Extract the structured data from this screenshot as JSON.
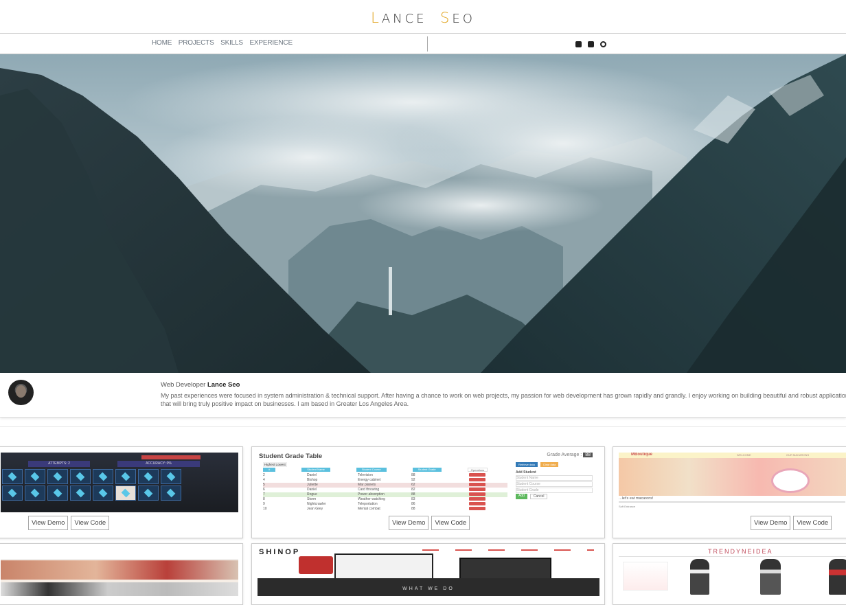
{
  "brand": {
    "first_initial": "L",
    "first_rest": "ANCE",
    "last_initial": "S",
    "last_rest": "EO",
    "accent_color": "#e0a21b"
  },
  "nav": {
    "links": [
      "HOME",
      "PROJECTS",
      "SKILLS",
      "EXPERIENCE"
    ]
  },
  "social": {
    "icons": [
      "linkedin-icon",
      "instagram-icon",
      "github-icon"
    ]
  },
  "bio": {
    "role": "Web Developer",
    "name": "Lance Seo",
    "text": "My past experiences were focused in system administration & technical support. After having a chance to work on web projects, my passion for web development has grown rapidly and grandly. I enjoy working on building beautiful and robust applications that will bring truly positive impact on businesses. I am based in Greater Los Angeles Area."
  },
  "projects": {
    "demo_label": "View Demo",
    "code_label": "View Code",
    "memory": {
      "banner": "ATTEMPTS: 2",
      "accuracy": "ACCURACY: 0%"
    },
    "grades": {
      "title": "Student Grade Table",
      "average_label": "Grade Average :",
      "average_value": "88",
      "sort_label": "Highest   Lowest",
      "headers": [
        "Student Name",
        "Student Course",
        "Student Grade",
        "Operations"
      ],
      "rows": [
        [
          "2",
          "Daniel",
          "Television",
          "88"
        ],
        [
          "4",
          "Bishop",
          "Energy cabinet",
          "92"
        ],
        [
          "5",
          "Juliette",
          "Mar planets",
          "62"
        ],
        [
          "6",
          "Daniel",
          "Card throwing",
          "82"
        ],
        [
          "7",
          "Rogue",
          "Power absorption",
          "88"
        ],
        [
          "8",
          "Storm",
          "Weather watching",
          "83"
        ],
        [
          "9",
          "Nightcrawler",
          "Teleportation",
          "86"
        ],
        [
          "10",
          "Jean Grey",
          "Mental combat",
          "88"
        ]
      ],
      "delete_label": "Delete",
      "add_title": "Add Student",
      "fields": [
        "Student Name",
        "Student Course",
        "Student Grade"
      ],
      "add_button": "Add",
      "cancel_button": "Cancel",
      "get_button": "Retrieve data",
      "clear_button": "Clear data"
    },
    "boutique": {
      "logo": "MBoutique",
      "nav": [
        "WELCOME",
        "OUR MACARONS"
      ],
      "heading": "...let's eat macarons!",
      "footer_text": "Soft Entrance"
    },
    "shinop": {
      "logo": "SHINOP",
      "tagline": "WHAT WE DO"
    },
    "trendy": {
      "logo": "TRENDYNEIDEA"
    }
  }
}
